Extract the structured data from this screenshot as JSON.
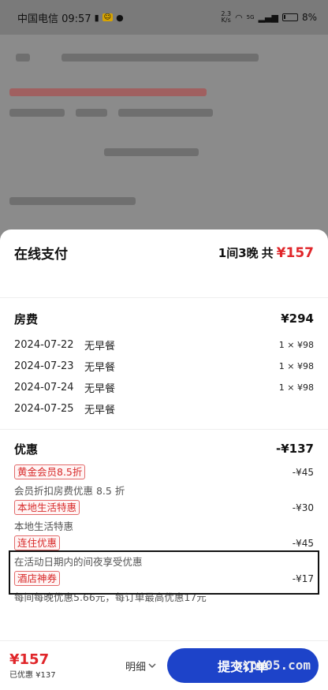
{
  "status_bar": {
    "carrier_time": "中国电信 09:57",
    "net_speed_top": "2.3",
    "net_speed_bottom": "K/s",
    "signal_label": "5G",
    "battery": "8%"
  },
  "sheet": {
    "title": "在线支付",
    "rooms_nights": "1间3晚",
    "total_label": "共",
    "total": "¥157"
  },
  "room_fee": {
    "title": "房费",
    "amount": "¥294",
    "nights": [
      {
        "date": "2024-07-22",
        "meal": "无早餐",
        "qty": "1 × ¥98"
      },
      {
        "date": "2024-07-23",
        "meal": "无早餐",
        "qty": "1 × ¥98"
      },
      {
        "date": "2024-07-24",
        "meal": "无早餐",
        "qty": "1 × ¥98"
      },
      {
        "date": "2024-07-25",
        "meal": "无早餐",
        "qty": ""
      }
    ]
  },
  "discounts": {
    "title": "优惠",
    "amount": "-¥137",
    "items": [
      {
        "tag": "黄金会员8.5折",
        "amount": "-¥45",
        "desc": "会员折扣房费优惠 8.5 折"
      },
      {
        "tag": "本地生活特惠",
        "amount": "-¥30",
        "desc": "本地生活特惠"
      },
      {
        "tag": "连住优惠",
        "amount": "-¥45",
        "desc": "在活动日期内的间夜享受优惠"
      },
      {
        "tag": "酒店神券",
        "amount": "-¥17",
        "desc": "每间每晚优惠5.66元，每订单最高优惠17元"
      }
    ]
  },
  "footer": {
    "price": "¥157",
    "saved": "已优惠 ¥137",
    "detail_label": "明细",
    "submit_label": "提交订单",
    "watermark": "nxpn05.com"
  }
}
